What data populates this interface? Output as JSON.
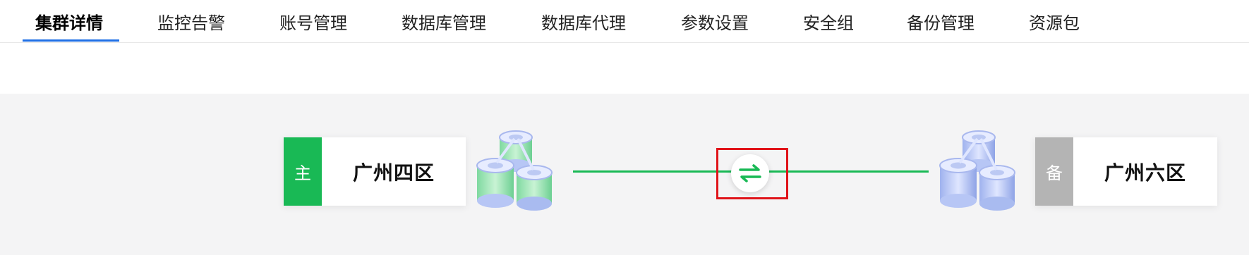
{
  "tabs": [
    {
      "label": "集群详情",
      "active": true
    },
    {
      "label": "监控告警",
      "active": false
    },
    {
      "label": "账号管理",
      "active": false
    },
    {
      "label": "数据库管理",
      "active": false
    },
    {
      "label": "数据库代理",
      "active": false
    },
    {
      "label": "参数设置",
      "active": false
    },
    {
      "label": "安全组",
      "active": false
    },
    {
      "label": "备份管理",
      "active": false
    },
    {
      "label": "资源包",
      "active": false
    }
  ],
  "primary": {
    "badge": "主",
    "region": "广州四区",
    "badge_color": "#19b955"
  },
  "standby": {
    "badge": "备",
    "region": "广州六区",
    "badge_color": "#b4b4b4"
  },
  "switch_icon": "swap-arrows-icon",
  "colors": {
    "accent": "#1f6fe5",
    "link": "#19b955",
    "highlight": "#e0141a"
  }
}
